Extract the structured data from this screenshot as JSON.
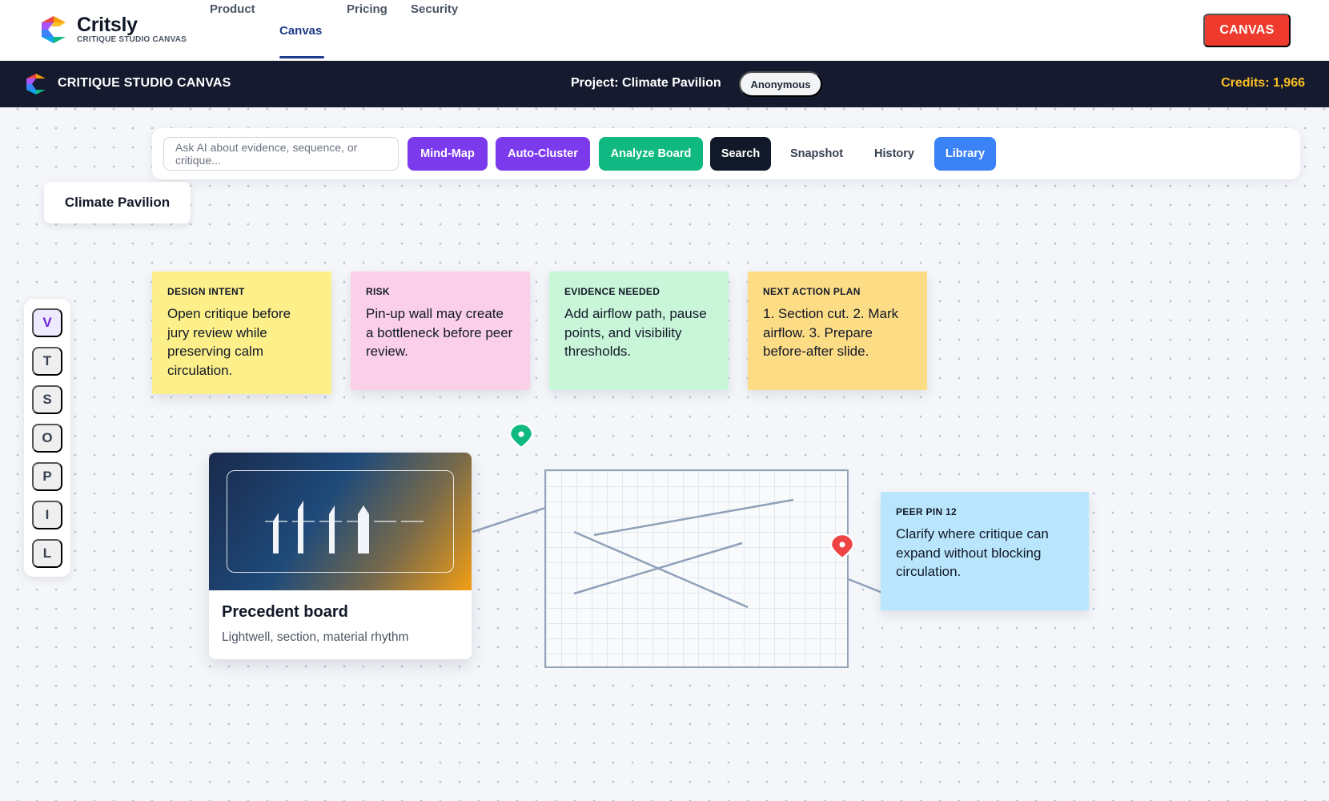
{
  "site": {
    "brand_name": "Critsly",
    "brand_sub": "CRITIQUE STUDIO CANVAS",
    "nav": [
      {
        "label": "Product"
      },
      {
        "label": "Canvas"
      },
      {
        "label": "Pricing"
      },
      {
        "label": "Security"
      }
    ],
    "active_nav": "Canvas",
    "cta_label": "CANVAS"
  },
  "appbar": {
    "title": "CRITIQUE STUDIO CANVAS",
    "project": "Project: Climate Pavilion",
    "identity": "Anonymous",
    "credits": "Credits: 1,966"
  },
  "toolbar": {
    "ai_placeholder": "Ask AI about evidence, sequence, or critique...",
    "buttons": {
      "mind_map": "Mind-Map",
      "auto_cluster": "Auto-Cluster",
      "analyze_board": "Analyze Board",
      "search": "Search",
      "snapshot": "Snapshot",
      "history": "History",
      "library": "Library"
    }
  },
  "board": {
    "title": "Climate Pavilion"
  },
  "tools": [
    "V",
    "T",
    "S",
    "O",
    "P",
    "I",
    "L"
  ],
  "active_tool": "V",
  "stickies": [
    {
      "heading": "DESIGN INTENT",
      "body": "Open critique before jury review while preserving calm circulation.",
      "color": "#fdf08a"
    },
    {
      "heading": "RISK",
      "body": "Pin-up wall may create a bottleneck before peer review.",
      "color": "#fbcfe8"
    },
    {
      "heading": "EVIDENCE NEEDED",
      "body": "Add airflow path, pause points, and visibility thresholds.",
      "color": "#c9f5d8"
    },
    {
      "heading": "NEXT ACTION PLAN",
      "body": "1. Section cut. 2. Mark airflow. 3. Prepare before-after slide.",
      "color": "#fddc86"
    }
  ],
  "precedent": {
    "title": "Precedent board",
    "subtitle": "Lightwell, section, material rhythm"
  },
  "peer_pin": {
    "heading": "PEER PIN 12",
    "body": "Clarify where critique can expand without blocking circulation.",
    "color": "#bae6fd"
  },
  "colors": {
    "accent_red": "#ef3b2d",
    "purple": "#7c3aed",
    "green": "#10b981",
    "blue": "#3b82f6",
    "appbar": "#151a2e",
    "credits": "#fbbf24",
    "pin_green": "#10b981",
    "pin_red": "#ef4444"
  }
}
